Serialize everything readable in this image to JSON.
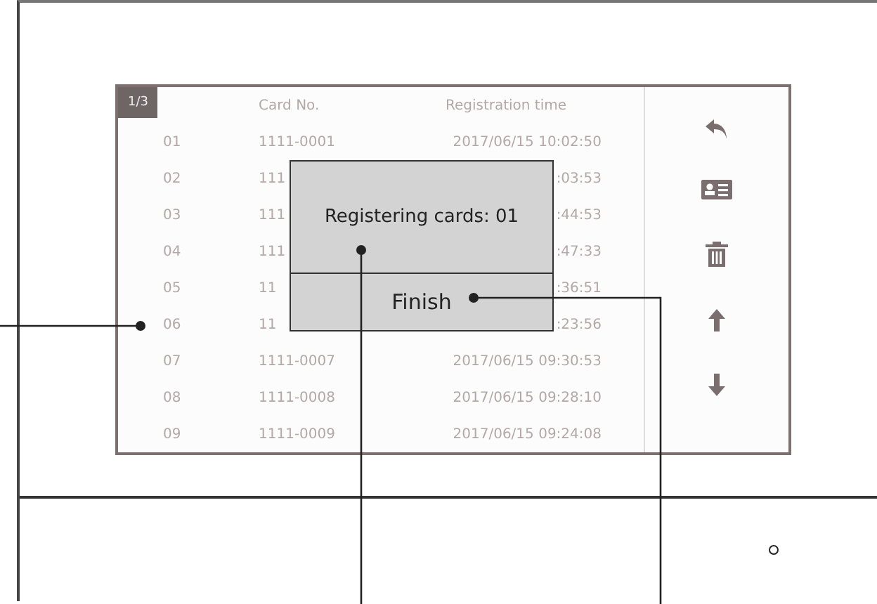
{
  "table": {
    "page_indicator": "1/3",
    "columns": [
      "Card No.",
      "Registration time"
    ],
    "rows": [
      {
        "index": "01",
        "card": "1111-0001",
        "time": "2017/06/15 10:02:50"
      },
      {
        "index": "02",
        "card": "111",
        "time": ":03:53"
      },
      {
        "index": "03",
        "card": "111",
        "time": ":44:53"
      },
      {
        "index": "04",
        "card": "111",
        "time": ":47:33"
      },
      {
        "index": "05",
        "card": "11",
        "time": ":36:51"
      },
      {
        "index": "06",
        "card": "11",
        "time": ":23:56"
      },
      {
        "index": "07",
        "card": "1111-0007",
        "time": "2017/06/15 09:30:53"
      },
      {
        "index": "08",
        "card": "1111-0008",
        "time": "2017/06/15 09:28:10"
      },
      {
        "index": "09",
        "card": "1111-0009",
        "time": "2017/06/15 09:24:08"
      }
    ]
  },
  "dialog": {
    "message": "Registering cards:  01",
    "button": "Finish"
  }
}
